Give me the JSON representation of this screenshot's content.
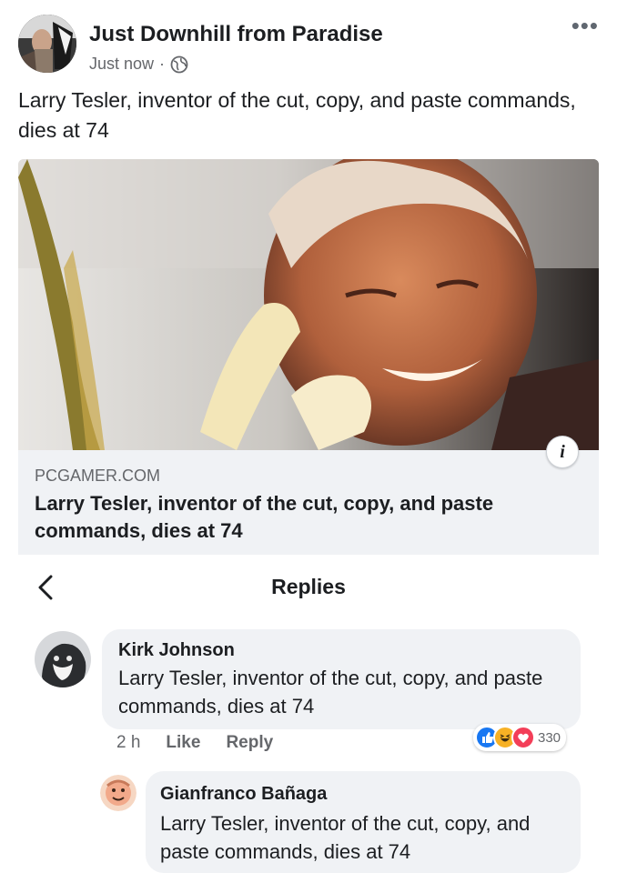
{
  "post": {
    "page_name": "Just Downhill from Paradise",
    "timestamp": "Just now",
    "separator": "·",
    "privacy_icon": "globe-icon",
    "more_icon": "more-options-icon",
    "more_label": "•••",
    "text": "Larry Tesler, inventor of the cut, copy, and paste commands, dies at 74"
  },
  "link_preview": {
    "domain": "PCGAMER.COM",
    "title": "Larry Tesler, inventor of the cut, copy, and paste commands, dies at 74",
    "info_label": "i"
  },
  "replies_header": {
    "title": "Replies",
    "back_icon": "chevron-left-icon"
  },
  "comments": [
    {
      "author": "Kirk Johnson",
      "text": "Larry Tesler, inventor of the cut, copy, and paste commands, dies at 74",
      "time": "2 h",
      "like_label": "Like",
      "reply_label": "Reply",
      "reactions": [
        "like",
        "haha",
        "love"
      ],
      "reaction_count": "330"
    },
    {
      "author": "Gianfranco Bañaga",
      "text": "Larry Tesler, inventor of the cut, copy, and paste commands, dies at 74"
    }
  ],
  "colors": {
    "like_blue": "#1877f2",
    "love_red": "#f33e58",
    "haha_yellow": "#f7b125",
    "bubble_gray": "#f0f2f5",
    "meta_gray": "#65676b"
  }
}
